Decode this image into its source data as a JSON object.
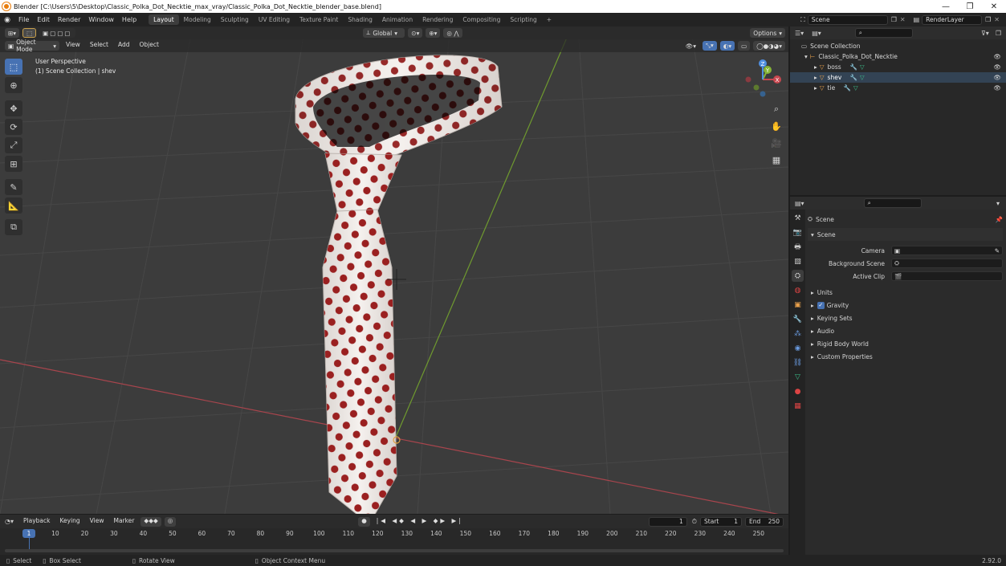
{
  "titlebar": {
    "title": "Blender [C:\\Users\\5\\Desktop\\Classic_Polka_Dot_Necktie_max_vray/Classic_Polka_Dot_Necktie_blender_base.blend]",
    "minimize": "—",
    "maximize": "❐",
    "close": "✕"
  },
  "menu": [
    "File",
    "Edit",
    "Render",
    "Window",
    "Help"
  ],
  "workspaces": [
    "Layout",
    "Modeling",
    "Sculpting",
    "UV Editing",
    "Texture Paint",
    "Shading",
    "Animation",
    "Rendering",
    "Compositing",
    "Scripting"
  ],
  "add_workspace": "+",
  "scene_field": "Scene",
  "renderlayer_field": "RenderLayer",
  "viewport": {
    "transform_orientation": "Global",
    "options_label": "Options",
    "mode": "Object Mode",
    "menus": [
      "View",
      "Select",
      "Add",
      "Object"
    ],
    "perspective": "User Perspective",
    "collection_info": "(1) Scene Collection | shev",
    "gizmo": {
      "x": "X",
      "y": "Y",
      "z": "Z"
    }
  },
  "outliner": {
    "root": "Scene Collection",
    "collection": "Classic_Polka_Dot_Necktie",
    "objects": [
      "boss",
      "shev",
      "tie"
    ]
  },
  "properties": {
    "header": "Scene",
    "panel": "Scene",
    "camera_label": "Camera",
    "background_scene_label": "Background Scene",
    "active_clip_label": "Active Clip",
    "sections": [
      "Units",
      "Gravity",
      "Keying Sets",
      "Audio",
      "Rigid Body World",
      "Custom Properties"
    ],
    "gravity_checked": true
  },
  "timeline": {
    "menus": [
      "Playback",
      "Keying",
      "View",
      "Marker"
    ],
    "current_frame": "1",
    "start_label": "Start",
    "start_value": "1",
    "end_label": "End",
    "end_value": "250",
    "ruler": [
      "1",
      "10",
      "20",
      "30",
      "40",
      "50",
      "60",
      "70",
      "80",
      "90",
      "100",
      "110",
      "120",
      "130",
      "140",
      "150",
      "160",
      "170",
      "180",
      "190",
      "200",
      "210",
      "220",
      "230",
      "240",
      "250"
    ]
  },
  "statusbar": {
    "select": "Select",
    "box_select": "Box Select",
    "rotate_view": "Rotate View",
    "context_menu": "Object Context Menu",
    "version": "2.92.0"
  },
  "colors": {
    "accent": "#4772b3",
    "x_axis": "#c8474f",
    "y_axis": "#86b536",
    "z_axis": "#4f8ee0",
    "polka_dot": "#9a2020",
    "tie_fabric": "#f3eeea"
  }
}
